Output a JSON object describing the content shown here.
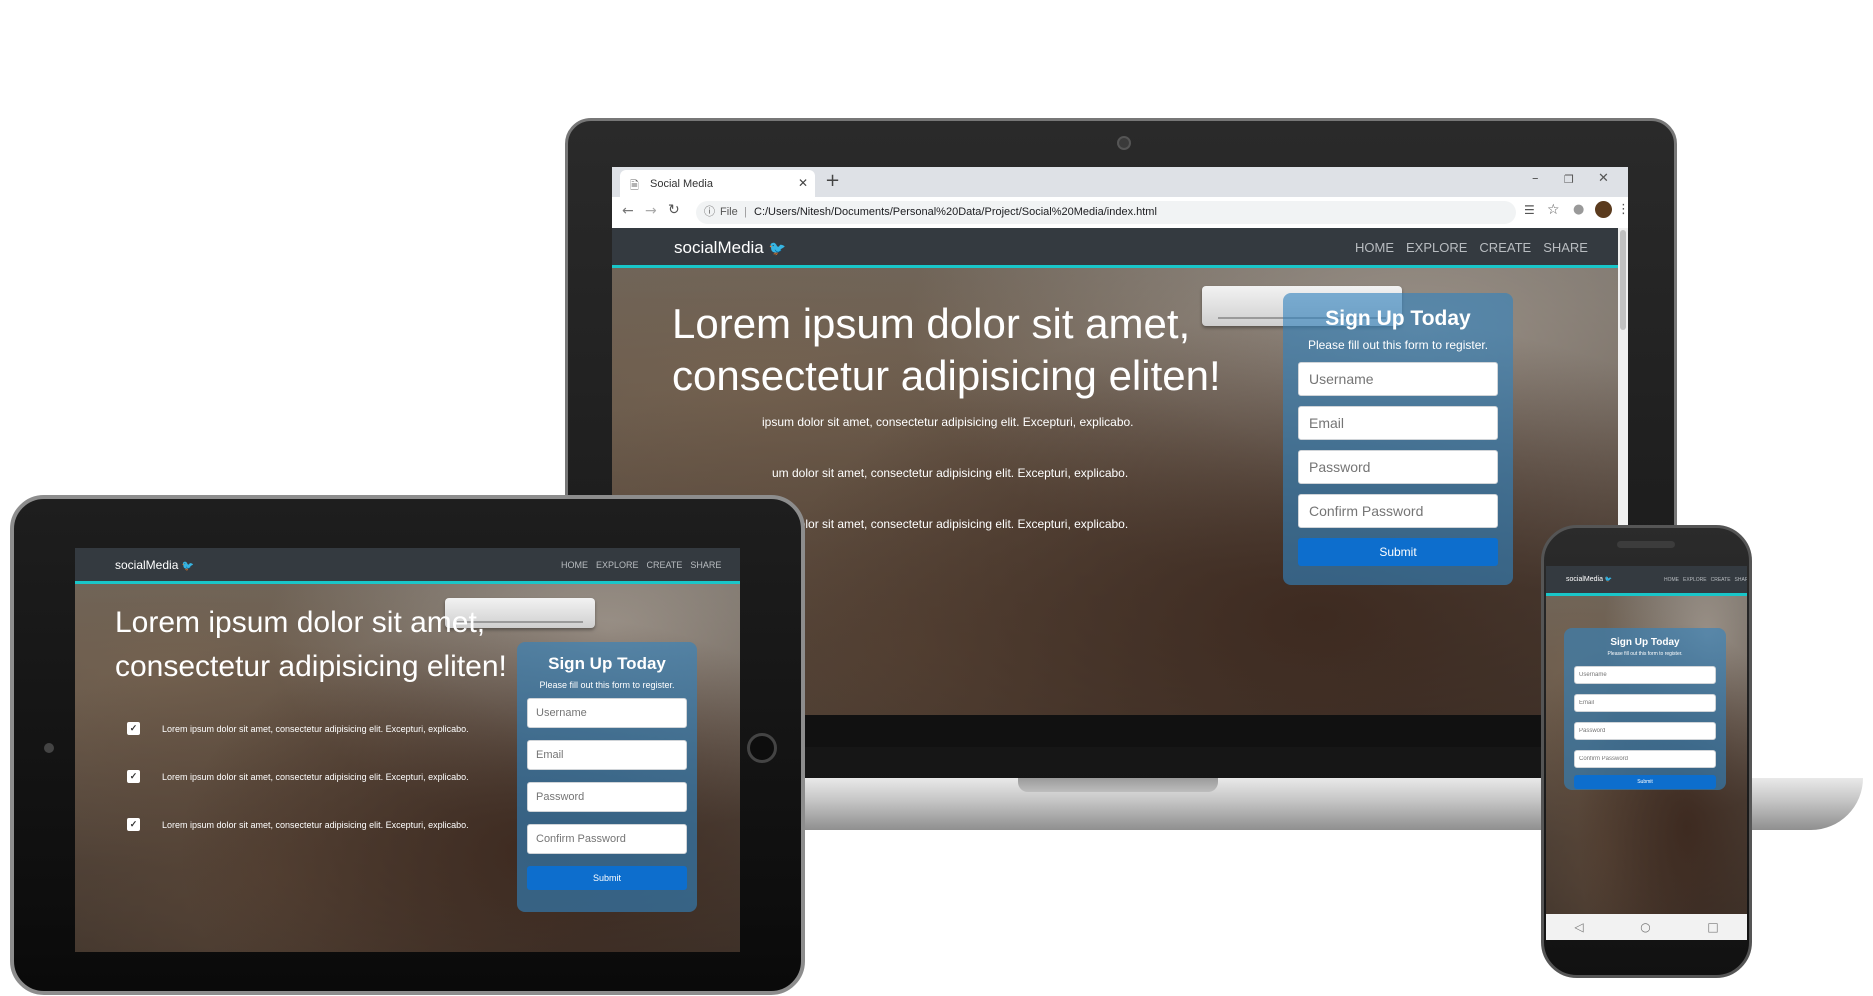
{
  "browser": {
    "tab_title": "Social Media",
    "new_tab_symbol": "+",
    "url_scheme": "File",
    "url": "C:/Users/Nitesh/Documents/Personal%20Data/Project/Social%20Media/index.html"
  },
  "site": {
    "brand": "socialMedia",
    "nav": [
      "HOME",
      "EXPLORE",
      "CREATE",
      "SHARE"
    ],
    "headline_line1": "Lorem ipsum dolor sit amet,",
    "headline_line2": "consectetur adipisicing eliten!",
    "features": [
      "Lorem ipsum dolor sit amet, consectetur adipisicing elit. Excepturi, explicabo.",
      "Lorem ipsum dolor sit amet, consectetur adipisicing elit. Excepturi, explicabo.",
      "Lorem ipsum dolor sit amet, consectetur adipisicing elit. Excepturi, explicabo."
    ],
    "laptop_features_visible": [
      "ipsum dolor sit amet, consectetur adipisicing elit. Excepturi, explicabo.",
      "um dolor sit amet, consectetur adipisicing elit. Excepturi, explicabo.",
      "um dolor sit amet, consectetur adipisicing elit. Excepturi, explicabo."
    ],
    "form": {
      "title": "Sign Up Today",
      "subtitle": "Please fill out this form to register.",
      "username_placeholder": "Username",
      "email_placeholder": "Email",
      "password_placeholder": "Password",
      "confirm_placeholder": "Confirm Password",
      "submit_label": "Submit"
    }
  },
  "colors": {
    "navbar": "#343a40",
    "accent": "#19c6c9",
    "card": "#3282be",
    "submit": "#0d6ecd"
  },
  "icons": {
    "brand": "twitter-bird-icon",
    "check": "checkmark-icon"
  }
}
